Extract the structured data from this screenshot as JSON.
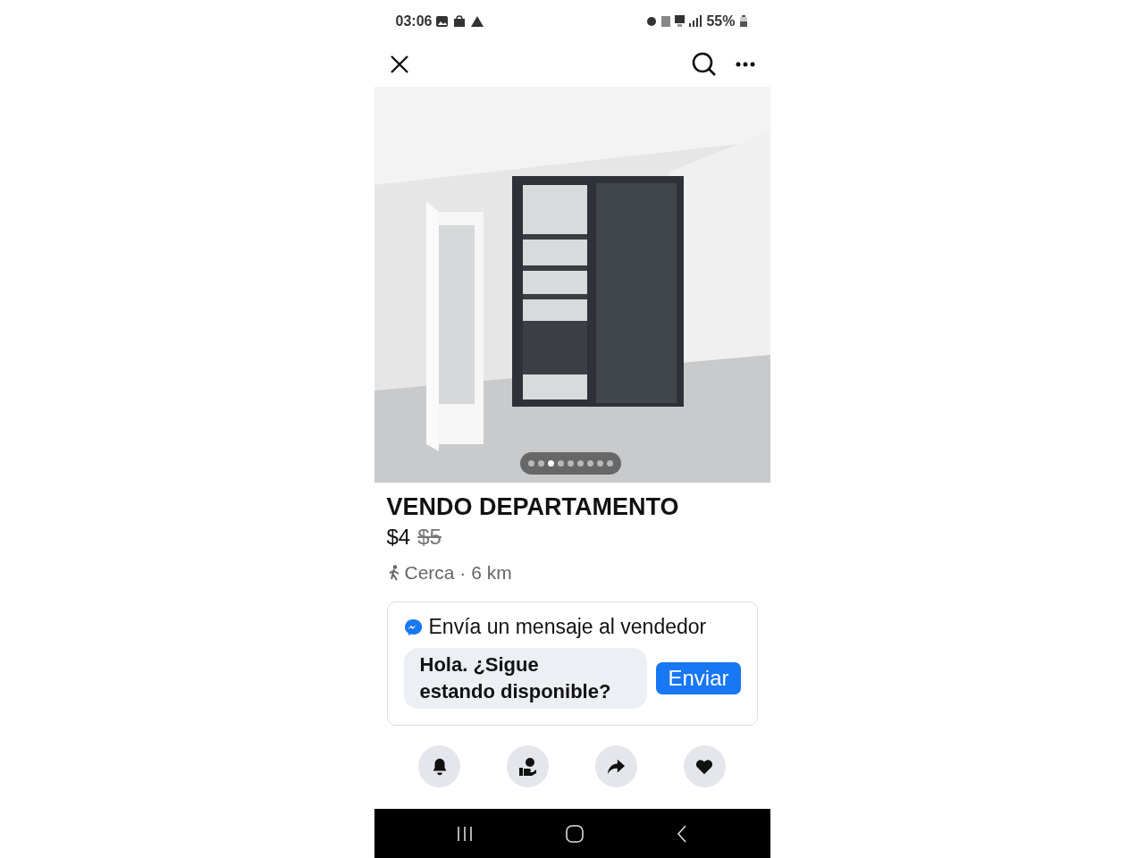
{
  "status_bar": {
    "time": "03:06",
    "battery": "55%"
  },
  "photo": {
    "dots": [
      {
        "selected": false
      },
      {
        "selected": false
      },
      {
        "selected": true
      },
      {
        "selected": false
      },
      {
        "selected": false
      },
      {
        "selected": false
      },
      {
        "selected": false
      },
      {
        "selected": false
      },
      {
        "selected": false
      }
    ]
  },
  "listing": {
    "title": "VENDO DEPARTAMENTO",
    "price": "$4",
    "original_price": "$5",
    "location": "Cerca · 6 km"
  },
  "message_card": {
    "heading": "Envía un mensaje al vendedor",
    "message": "Hola. ¿Sigue\nestando disponible?",
    "button": "Enviar"
  },
  "actions": [
    {
      "kind": "bell"
    },
    {
      "kind": "hand"
    },
    {
      "kind": "share"
    },
    {
      "kind": "heart"
    }
  ]
}
